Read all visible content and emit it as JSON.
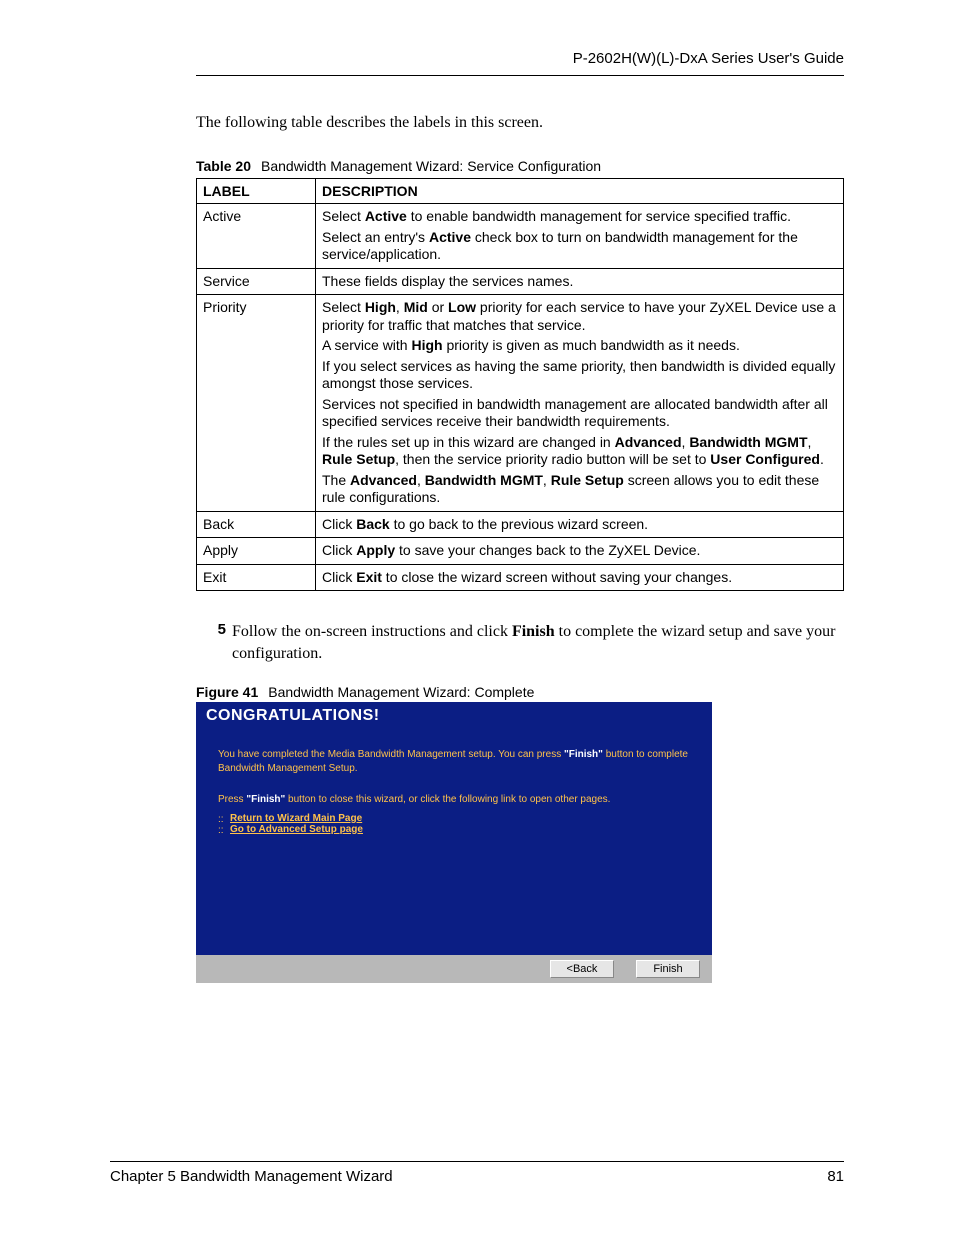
{
  "header": {
    "right": "P-2602H(W)(L)-DxA Series User's Guide"
  },
  "intro": "The following table describes the labels in this screen.",
  "table": {
    "caption_bold": "Table 20",
    "caption_rest": "Bandwidth Management Wizard: Service Configuration",
    "head": {
      "label": "LABEL",
      "desc": "DESCRIPTION"
    },
    "rows": [
      {
        "label": "Active",
        "desc": [
          {
            "pre": "Select ",
            "b": "Active",
            "post": " to enable bandwidth management for service specified traffic."
          },
          {
            "pre": "Select an entry's ",
            "b": "Active",
            "post": " check box to turn on bandwidth management for the service/application."
          }
        ]
      },
      {
        "label": "Service",
        "desc": [
          {
            "pre": "These fields display the services names.",
            "b": "",
            "post": ""
          }
        ]
      },
      {
        "label": "Priority",
        "desc_paragraphs": [
          "Select <b>High</b>, <b>Mid</b> or <b>Low</b> priority for each service to have your ZyXEL Device use a priority for traffic that matches that service.",
          "A service with <b>High</b> priority is given as much bandwidth as it needs.",
          "If you select services as having the same priority, then bandwidth is divided equally amongst those services.",
          "Services not specified in bandwidth management are allocated bandwidth after all specified services receive their bandwidth requirements.",
          "If the rules set up in this wizard are changed in <b>Advanced</b>, <b>Bandwidth MGMT</b>, <b>Rule Setup</b>, then the service priority radio button will be set to <b>User Configured</b>.",
          "The <b>Advanced</b>, <b>Bandwidth MGMT</b>, <b>Rule Setup</b> screen allows you to edit these rule configurations."
        ]
      },
      {
        "label": "Back",
        "desc": [
          {
            "pre": "Click ",
            "b": "Back",
            "post": " to go back to the previous wizard screen."
          }
        ]
      },
      {
        "label": "Apply",
        "desc": [
          {
            "pre": "Click ",
            "b": "Apply",
            "post": " to save your changes back to the ZyXEL Device."
          }
        ]
      },
      {
        "label": "Exit",
        "desc": [
          {
            "pre": "Click ",
            "b": "Exit",
            "post": " to close the wizard screen without saving your changes."
          }
        ]
      }
    ]
  },
  "step": {
    "num": "5",
    "text_pre": "Follow the on-screen instructions and click ",
    "text_bold": "Finish",
    "text_post": " to complete the wizard setup and save your configuration."
  },
  "figure": {
    "caption_bold": "Figure 41",
    "caption_rest": "Bandwidth Management Wizard: Complete"
  },
  "wizard": {
    "title": "CONGRATULATIONS!",
    "msg1_pre": "You have completed the Media Bandwidth Management setup. You can press ",
    "msg1_bold": "\"Finish\"",
    "msg1_post": " button to complete Bandwidth Management Setup.",
    "msg2_pre": "Press ",
    "msg2_bold": "\"Finish\"",
    "msg2_post": " button to close this wizard, or click the following link to open other pages.",
    "link1": "Return to Wizard Main Page",
    "link2": "Go to Advanced Setup page",
    "btn_back": "<Back",
    "btn_finish": "Finish"
  },
  "footer": {
    "left": "Chapter 5 Bandwidth Management Wizard",
    "right": "81"
  }
}
